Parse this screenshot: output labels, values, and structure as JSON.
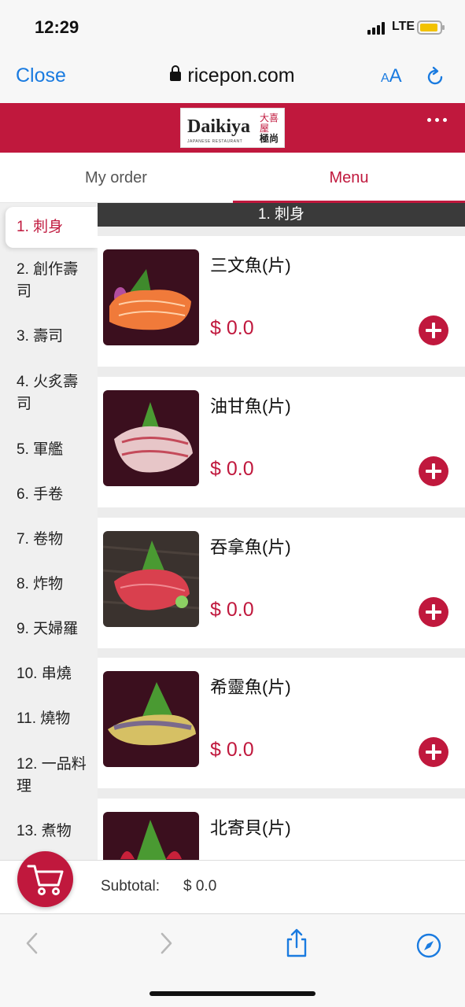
{
  "status_bar": {
    "time": "12:29",
    "network": "LTE"
  },
  "browser": {
    "close_label": "Close",
    "url": "ricepon.com",
    "text_size_label": "AA"
  },
  "header": {
    "logo_text": "Daikiya",
    "logo_sub": "JAPANESE RESTAURANT",
    "logo_kanji": "大喜屋",
    "logo_kanji2": "極尚"
  },
  "tabs": [
    {
      "label": "My order"
    },
    {
      "label": "Menu"
    }
  ],
  "categories": [
    {
      "label": "1. 刺身"
    },
    {
      "label": "2. 創作壽司"
    },
    {
      "label": "3. 壽司"
    },
    {
      "label": "4. 火炙壽司"
    },
    {
      "label": "5. 軍艦"
    },
    {
      "label": "6. 手卷"
    },
    {
      "label": "7. 卷物"
    },
    {
      "label": "8. 炸物"
    },
    {
      "label": "9. 天婦羅"
    },
    {
      "label": "10. 串燒"
    },
    {
      "label": "11. 燒物"
    },
    {
      "label": "12. 一品料理"
    },
    {
      "label": "13. 煮物"
    }
  ],
  "section_title": "1. 刺身",
  "items": [
    {
      "name": "三文魚(片)",
      "price": "$ 0.0"
    },
    {
      "name": "油甘魚(片)",
      "price": "$ 0.0"
    },
    {
      "name": "吞拿魚(片)",
      "price": "$ 0.0"
    },
    {
      "name": "希靈魚(片)",
      "price": "$ 0.0"
    },
    {
      "name": "北寄貝(片)",
      "price": ""
    }
  ],
  "cart": {
    "subtotal_label": "Subtotal:",
    "subtotal_value": "$ 0.0"
  },
  "colors": {
    "brand": "#c0183d",
    "link": "#1a7be0",
    "section_bar": "#3a3a3a"
  }
}
